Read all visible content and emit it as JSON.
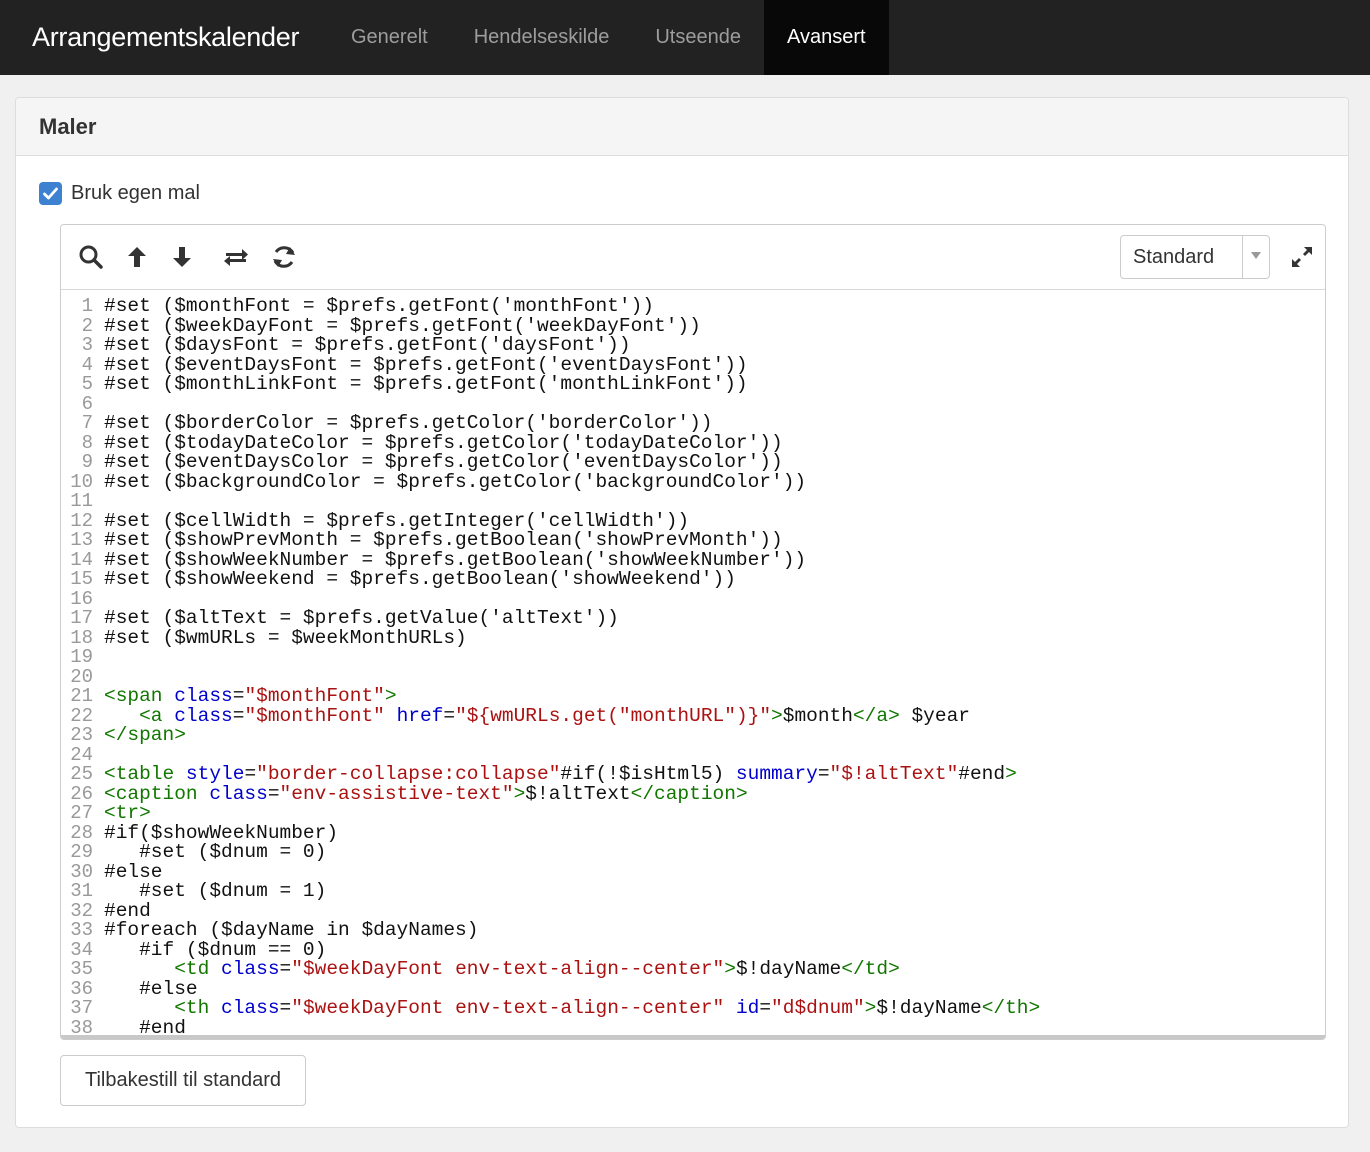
{
  "app": {
    "title": "Arrangementskalender",
    "tabs": [
      {
        "label": "Generelt",
        "active": false
      },
      {
        "label": "Hendelseskilde",
        "active": false
      },
      {
        "label": "Utseende",
        "active": false
      },
      {
        "label": "Avansert",
        "active": true
      }
    ]
  },
  "panel": {
    "title": "Maler",
    "checkbox": {
      "label": "Bruk egen mal",
      "checked": true
    }
  },
  "editor": {
    "toolbar": {
      "icons": [
        "search-icon",
        "arrow-up-icon",
        "arrow-down-icon",
        "swap-icon",
        "refresh-icon",
        "expand-icon"
      ],
      "theme_select": {
        "value": "Standard"
      }
    },
    "code_lines": [
      "#set ($monthFont = $prefs.getFont('monthFont'))",
      "#set ($weekDayFont = $prefs.getFont('weekDayFont'))",
      "#set ($daysFont = $prefs.getFont('daysFont'))",
      "#set ($eventDaysFont = $prefs.getFont('eventDaysFont'))",
      "#set ($monthLinkFont = $prefs.getFont('monthLinkFont'))",
      "",
      "#set ($borderColor = $prefs.getColor('borderColor'))",
      "#set ($todayDateColor = $prefs.getColor('todayDateColor'))",
      "#set ($eventDaysColor = $prefs.getColor('eventDaysColor'))",
      "#set ($backgroundColor = $prefs.getColor('backgroundColor'))",
      "",
      "#set ($cellWidth = $prefs.getInteger('cellWidth'))",
      "#set ($showPrevMonth = $prefs.getBoolean('showPrevMonth'))",
      "#set ($showWeekNumber = $prefs.getBoolean('showWeekNumber'))",
      "#set ($showWeekend = $prefs.getBoolean('showWeekend'))",
      "",
      "#set ($altText = $prefs.getValue('altText'))",
      "#set ($wmURLs = $weekMonthURLs)",
      "",
      "",
      "<span class=\"$monthFont\">",
      "   <a class=\"$monthFont\" href=\"${wmURLs.get(\"monthURL\")}\">$month</a> $year",
      "</span>",
      "",
      "<table style=\"border-collapse:collapse\"#if(!$isHtml5) summary=\"$!altText\"#end>",
      "<caption class=\"env-assistive-text\">$!altText</caption>",
      "<tr>",
      "#if($showWeekNumber)",
      "   #set ($dnum = 0)",
      "#else",
      "   #set ($dnum = 1)",
      "#end",
      "#foreach ($dayName in $dayNames)",
      "   #if ($dnum == 0)",
      "      <td class=\"$weekDayFont env-text-align--center\">$!dayName</td>",
      "   #else",
      "      <th class=\"$weekDayFont env-text-align--center\" id=\"d$dnum\">$!dayName</th>",
      "   #end"
    ]
  },
  "reset_button": {
    "label": "Tilbakestill til standard"
  }
}
